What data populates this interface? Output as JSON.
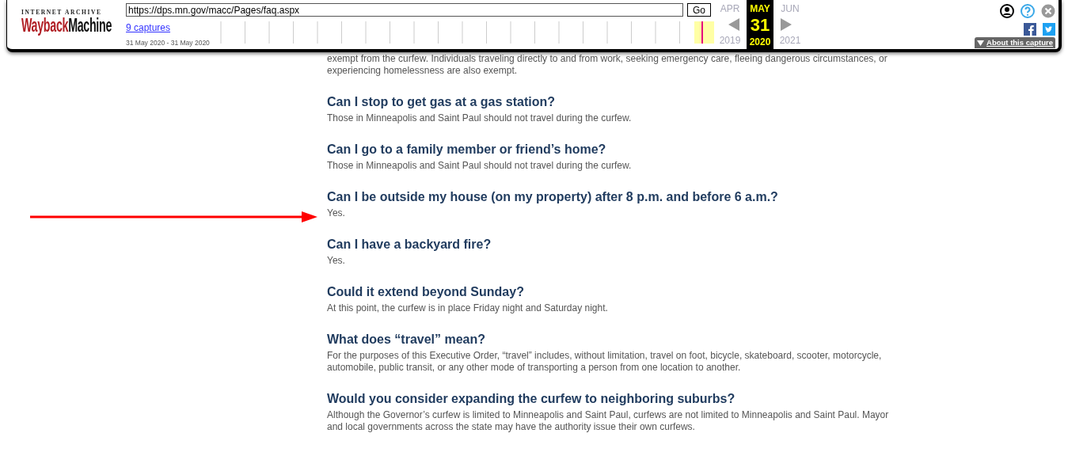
{
  "toolbar": {
    "logo_top": "INTERNET ARCHIVE",
    "logo_left": "Wayback",
    "logo_right": "Machine",
    "url": "https://dps.mn.gov/macc/Pages/faq.aspx",
    "go_button": "Go",
    "captures_link": "9 captures",
    "date_range": "31 May 2020 - 31 May 2020",
    "calendar": [
      {
        "month": "APR",
        "year": "2019",
        "selected": false
      },
      {
        "month": "MAY",
        "day": "31",
        "year": "2020",
        "selected": true
      },
      {
        "month": "JUN",
        "year": "2021",
        "selected": false
      }
    ],
    "about_button": "About this capture"
  },
  "faq": {
    "lead_text": "exempt from the curfew. Individuals traveling directly to and from work, seeking emergency care, fleeing dangerous circumstances, or experiencing homelessness are also exempt.",
    "items": [
      {
        "question": "Can I stop to get gas at a gas station?",
        "answer": "Those in Minneapolis and Saint Paul should not travel during the curfew.",
        "arrow": false
      },
      {
        "question": "Can I go to a family member or friend’s home?",
        "answer": "Those in Minneapolis and Saint Paul should not travel during the curfew.",
        "arrow": false
      },
      {
        "question": "Can I be outside my house (on my property) after 8 p.m. and before 6 a.m.?",
        "answer": "Yes.",
        "arrow": true
      },
      {
        "question": "Can I have a backyard fire?",
        "answer": "Yes.",
        "arrow": false
      },
      {
        "question": "Could it extend beyond Sunday?",
        "answer": "At this point, the curfew is in place Friday night and Saturday night.",
        "arrow": false
      },
      {
        "question": "What does “travel” mean?",
        "answer": "For the purposes of this Executive Order, “travel” includes, without limitation, travel on foot, bicycle, skateboard, scooter, motorcycle, automobile, public transit, or any other mode of transporting a person from one location to another.",
        "arrow": false
      },
      {
        "question": "Would you consider expanding the curfew to neighboring suburbs?",
        "answer": "Although the Governor’s curfew is limited to Minneapolis and Saint Paul, curfews are not limited to Minneapolis and Saint Paul. Mayor and local governments across the state may have the authority issue their own curfews.",
        "arrow": false
      }
    ]
  }
}
